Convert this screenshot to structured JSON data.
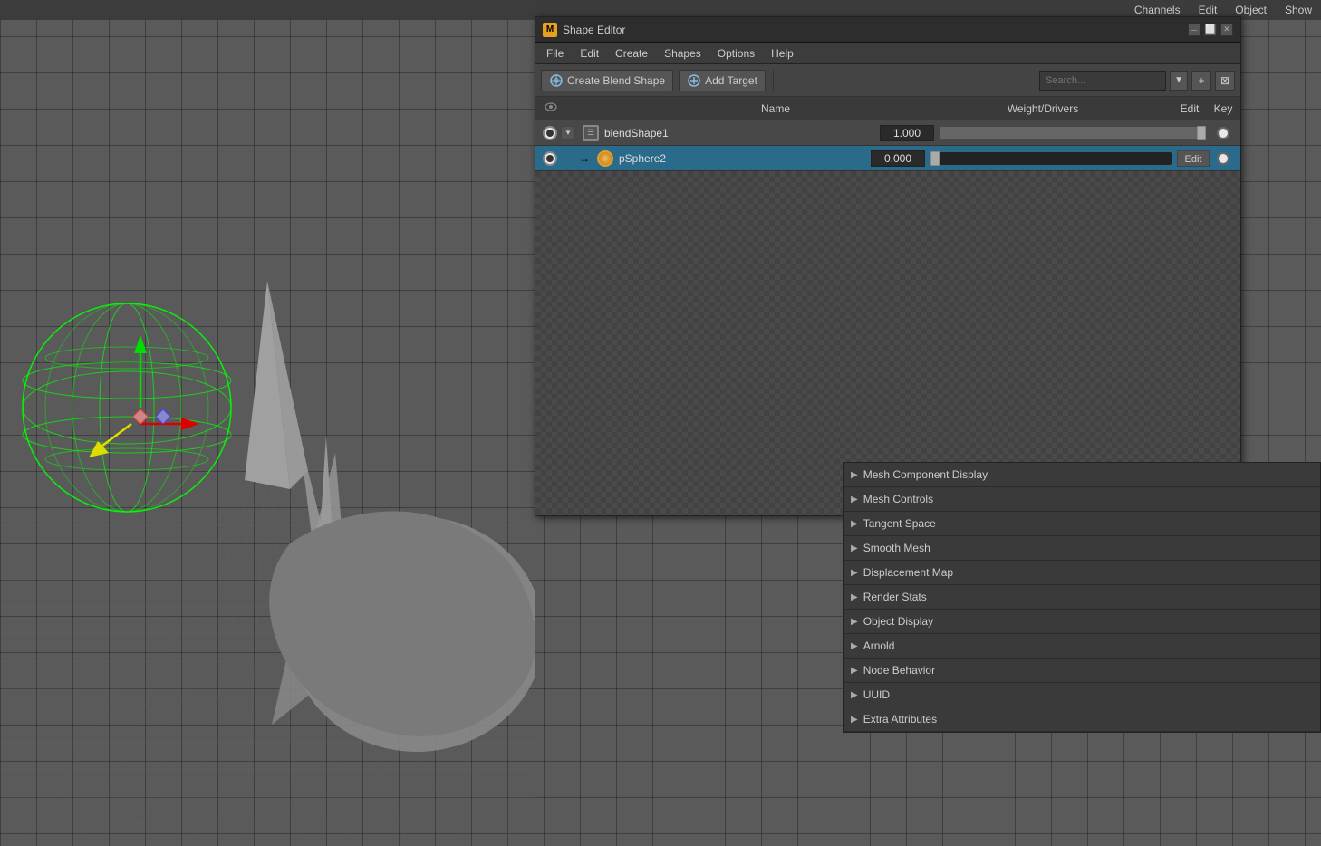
{
  "topbar": {
    "items": [
      "Channels",
      "Edit",
      "Object",
      "Show"
    ]
  },
  "shapeEditor": {
    "title": "Shape Editor",
    "titleIcon": "M",
    "menus": [
      "File",
      "Edit",
      "Create",
      "Shapes",
      "Options",
      "Help"
    ],
    "toolbar": {
      "createBlendShape": "Create Blend Shape",
      "addTarget": "Add Target",
      "searchPlaceholder": "Search..."
    },
    "columns": {
      "name": "Name",
      "weightDrivers": "Weight/Drivers",
      "edit": "Edit",
      "key": "Key"
    },
    "rows": [
      {
        "id": "blendShape1",
        "name": "blendShape1",
        "value": "1.000",
        "sliderFillPct": 100,
        "thumbPct": 98,
        "isSelected": false,
        "hasEditBtn": false,
        "radioFilled": true
      },
      {
        "id": "pSphere2",
        "name": "pSphere2",
        "value": "0.000",
        "sliderFillPct": 2,
        "thumbPct": 2,
        "isSelected": true,
        "hasEditBtn": true,
        "radioFilled": true
      }
    ]
  },
  "attrEditor": {
    "sections": [
      {
        "label": "Mesh Component Display",
        "expanded": false
      },
      {
        "label": "Mesh Controls",
        "expanded": false
      },
      {
        "label": "Tangent Space",
        "expanded": false
      },
      {
        "label": "Smooth Mesh",
        "expanded": false
      },
      {
        "label": "Displacement Map",
        "expanded": false
      },
      {
        "label": "Render Stats",
        "expanded": false
      },
      {
        "label": "Object Display",
        "expanded": false
      },
      {
        "label": "Arnold",
        "expanded": false
      },
      {
        "label": "Node Behavior",
        "expanded": false
      },
      {
        "label": "UUID",
        "expanded": false
      },
      {
        "label": "Extra Attributes",
        "expanded": false
      }
    ]
  },
  "icons": {
    "eye": "👁",
    "expand": "▸",
    "collapse": "▾",
    "create": "✦",
    "addTarget": "⊕",
    "search": "🔍",
    "folder": "📁",
    "minus": "─",
    "restore": "⬜",
    "close": "✕",
    "arrowRight": "▶"
  }
}
